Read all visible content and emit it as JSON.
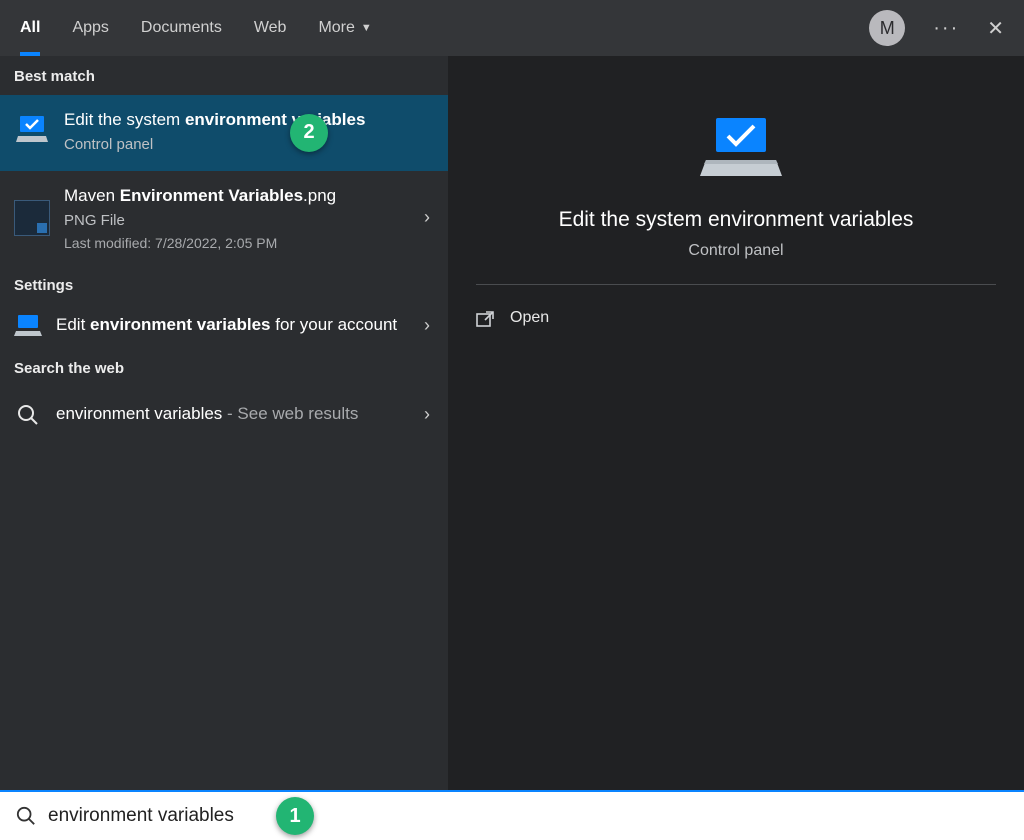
{
  "topbar": {
    "tabs": [
      {
        "label": "All",
        "active": true
      },
      {
        "label": "Apps",
        "active": false
      },
      {
        "label": "Documents",
        "active": false
      },
      {
        "label": "Web",
        "active": false
      },
      {
        "label": "More",
        "active": false,
        "hasChevron": true
      }
    ],
    "avatar_initial": "M",
    "ellipsis": "···",
    "close": "✕"
  },
  "left": {
    "sections": {
      "best_match_header": "Best match",
      "settings_header": "Settings",
      "web_header": "Search the web"
    },
    "best_match": {
      "title_pre": "Edit the system ",
      "title_bold": "environment variables",
      "subtitle": "Control panel"
    },
    "file_result": {
      "title_pre": "Maven ",
      "title_bold": "Environment Variables",
      "title_post": ".png",
      "subtitle": "PNG File",
      "meta": "Last modified: 7/28/2022, 2:05 PM"
    },
    "settings_result": {
      "title_pre": "Edit ",
      "title_bold": "environment variables",
      "title_post": " for your account"
    },
    "web_result": {
      "title": "environment variables",
      "suffix": " - See web results"
    },
    "callout_2": "2"
  },
  "right": {
    "preview_title": "Edit the system environment variables",
    "preview_sub": "Control panel",
    "action_open": "Open"
  },
  "search": {
    "icon_name": "search-icon",
    "value": "environment variables",
    "callout_1": "1"
  }
}
